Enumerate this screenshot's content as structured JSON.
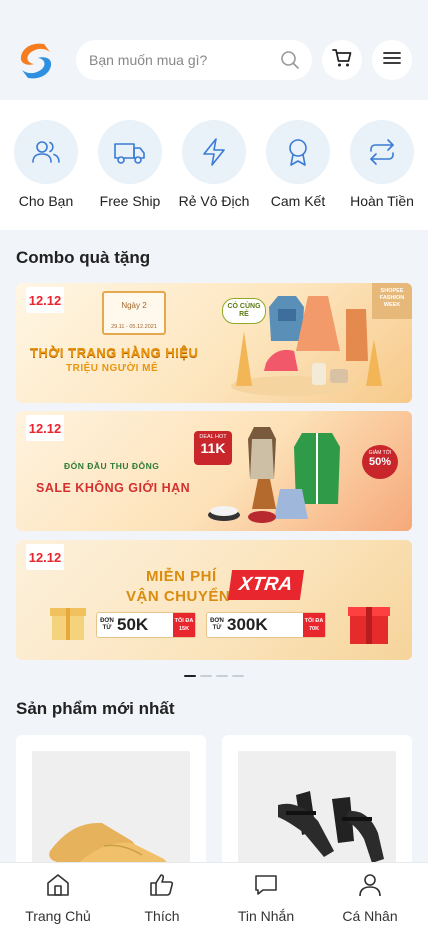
{
  "header": {
    "search_placeholder": "Bạn muốn mua gì?",
    "icons": [
      "logo",
      "search-icon",
      "cart-icon",
      "menu-icon"
    ]
  },
  "categories": [
    {
      "label": "Cho Bạn",
      "icon": "users-icon"
    },
    {
      "label": "Free Ship",
      "icon": "truck-icon"
    },
    {
      "label": "Rẻ Vô Địch",
      "icon": "lightning-icon"
    },
    {
      "label": "Cam Kết",
      "icon": "award-icon"
    },
    {
      "label": "Hoàn Tiền",
      "icon": "refresh-icon"
    }
  ],
  "combo": {
    "title": "Combo quà tặng",
    "banners": [
      {
        "tag": "12.12",
        "line1": "THỜI TRANG HÀNG HIỆU",
        "line2": "TRIỆU NGƯỜI MÊ",
        "date_label": "Ngày 2",
        "date_range": "29.11 - 05.12.2021",
        "corner": "SHOPEE FASHION WEEK",
        "badge": "CÓ CÙNG RẺ"
      },
      {
        "tag": "12.12",
        "line1": "ĐÓN ĐẦU THU ĐÔNG",
        "line2": "SALE KHÔNG GIỚI HẠN",
        "deal_label": "DEAL HOT",
        "deal_value": "11K",
        "discount_label": "GIẢM TỚI",
        "discount_value": "50%"
      },
      {
        "tag": "12.12",
        "line1": "MIỄN PHÍ",
        "line2": "VẬN CHUYỂN",
        "xtra": "XTRA",
        "v1_prefix": "ĐƠN TỪ",
        "v1_value": "50K",
        "v1_max": "TỐI ĐA 15K",
        "v2_prefix": "ĐƠN TỪ",
        "v2_value": "300K",
        "v2_max": "TỐI ĐA 70K"
      }
    ],
    "active_slide": 1,
    "slide_count": 4
  },
  "new_products": {
    "title": "Sản phẩm mới nhất",
    "items": [
      {
        "image": "yellow-flat-shoes"
      },
      {
        "image": "black-strappy-heels"
      }
    ]
  },
  "bottom_nav": [
    {
      "label": "Trang Chủ",
      "icon": "home-icon"
    },
    {
      "label": "Thích",
      "icon": "thumbs-up-icon"
    },
    {
      "label": "Tin Nhắn",
      "icon": "message-icon"
    },
    {
      "label": "Cá Nhân",
      "icon": "user-icon"
    }
  ],
  "colors": {
    "background": "#f1f4f8",
    "icon_bg": "#e9f1f9",
    "icon_stroke": "#3a7bd5",
    "logo_orange": "#f57c1f",
    "logo_blue": "#2f8fe0",
    "promo_red": "#e8262d"
  }
}
